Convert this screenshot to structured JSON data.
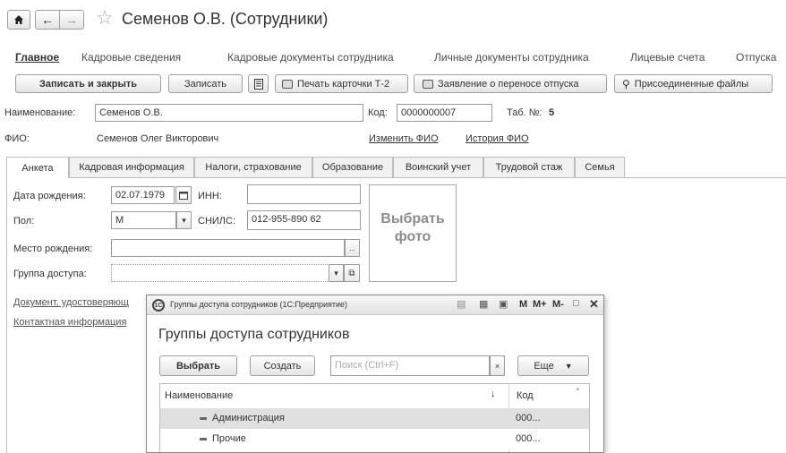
{
  "window": {
    "title": "Семенов О.В. (Сотрудники)"
  },
  "nav": {
    "items": [
      {
        "label": "Главное"
      },
      {
        "label": "Кадровые сведения"
      },
      {
        "label": "Кадровые документы сотрудника"
      },
      {
        "label": "Личные документы сотрудника"
      },
      {
        "label": "Лицевые счета"
      },
      {
        "label": "Отпуска"
      }
    ]
  },
  "toolbar": {
    "save_close": "Записать и закрыть",
    "save": "Записать",
    "print_t2": "Печать карточки Т-2",
    "transfer_leave": "Заявление о переносе отпуска",
    "attached_files": "Присоединенные файлы"
  },
  "header": {
    "name_label": "Наименование:",
    "name_value": "Семенов О.В.",
    "code_label": "Код:",
    "code_value": "0000000007",
    "tab_num_label": "Таб. №:",
    "tab_num_value": "5",
    "fio_label": "ФИО:",
    "fio_value": "Семенов Олег Викторович",
    "change_fio": "Изменить ФИО",
    "fio_history": "История ФИО"
  },
  "tabs": [
    {
      "label": "Анкета"
    },
    {
      "label": "Кадровая информация"
    },
    {
      "label": "Налоги, страхование"
    },
    {
      "label": "Образование"
    },
    {
      "label": "Воинский учет"
    },
    {
      "label": "Трудовой стаж"
    },
    {
      "label": "Семья"
    }
  ],
  "form": {
    "birth_date_label": "Дата рождения:",
    "birth_date_value": "02.07.1979",
    "inn_label": "ИНН:",
    "inn_value": "",
    "gender_label": "Пол:",
    "gender_value": "М",
    "snils_label": "СНИЛС:",
    "snils_value": "012-955-890 62",
    "birth_place_label": "Место рождения:",
    "birth_place_value": "",
    "access_group_label": "Группа доступа:",
    "access_group_value": "",
    "photo_label_1": "Выбрать",
    "photo_label_2": "фото",
    "id_doc_link": "Документ, удостоверяющ",
    "contact_link": "Контактная информация"
  },
  "dialog": {
    "title_bar": "Группы доступа сотрудников (1С:Предприятие)",
    "heading": "Группы доступа сотрудников",
    "select_btn": "Выбрать",
    "create_btn": "Создать",
    "search_placeholder": "Поиск (Ctrl+F)",
    "more_btn": "Еще",
    "tb_m": "M",
    "tb_mplus": "M+",
    "tb_mminus": "M-",
    "col_name": "Наименование",
    "col_code": "Код",
    "rows": [
      {
        "name": "Администрация",
        "code": "000..."
      },
      {
        "name": "Прочие",
        "code": "000..."
      }
    ]
  }
}
